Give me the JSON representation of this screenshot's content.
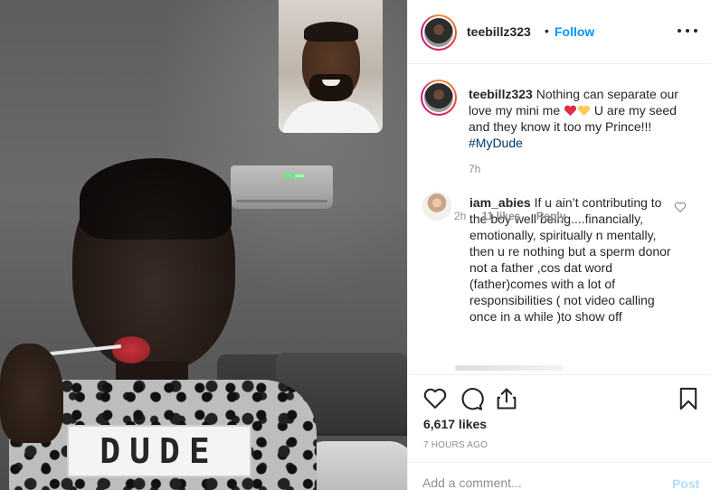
{
  "post": {
    "username": "teebillz323",
    "separator": "•",
    "follow_label": "Follow",
    "more_icon": "more-horizontal-icon"
  },
  "caption": {
    "username": "teebillz323",
    "text_part1": "Nothing can separate our love my mini me",
    "text_part2": "U are my seed and they know it too my Prince!!!",
    "hashtag": "#MyDude",
    "time": "7h",
    "emoji": [
      "red-heart-icon",
      "yellow-heart-icon"
    ]
  },
  "comment": {
    "username": "iam_abies",
    "text": "If u ain’t contributing to the boy well being....financially, emotionally, spiritually n mentally, then u re nothing but a sperm donor not a father ,cos dat word (father)comes with a lot of responsibilities ( not video calling once in a while )to show off",
    "time": "2h",
    "likes": "11 likes",
    "reply_label": "Reply"
  },
  "actions": {
    "icons": [
      "heart-icon",
      "comment-icon",
      "share-icon",
      "bookmark-icon"
    ],
    "likes_count": "6,617 likes",
    "posted": "7 HOURS AGO"
  },
  "add_comment": {
    "placeholder": "Add a comment...",
    "post_label": "Post"
  },
  "media": {
    "shirt_text": "DUDE",
    "colors": {
      "accent": "#0095f6",
      "hashtag": "#00376b",
      "muted": "#8e8e8e",
      "post_disabled": "#b2dffc"
    }
  }
}
